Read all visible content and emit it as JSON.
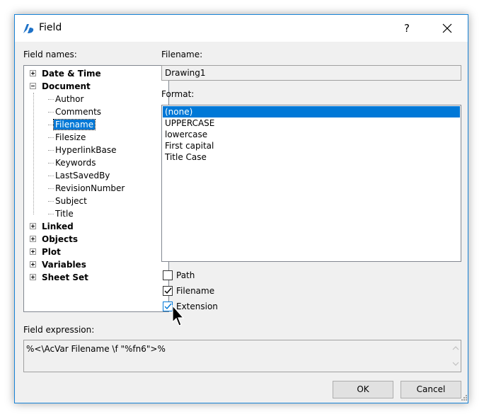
{
  "window": {
    "title": "Field",
    "help_label": "?"
  },
  "field_names": {
    "label": "Field names:",
    "tree": [
      {
        "label": "Date & Time",
        "bold": true,
        "expander": "plus"
      },
      {
        "label": "Document",
        "bold": true,
        "expander": "minus"
      },
      {
        "label": "Author",
        "child": true
      },
      {
        "label": "Comments",
        "child": true
      },
      {
        "label": "Filename",
        "child": true,
        "selected": true
      },
      {
        "label": "Filesize",
        "child": true
      },
      {
        "label": "HyperlinkBase",
        "child": true
      },
      {
        "label": "Keywords",
        "child": true
      },
      {
        "label": "LastSavedBy",
        "child": true
      },
      {
        "label": "RevisionNumber",
        "child": true
      },
      {
        "label": "Subject",
        "child": true
      },
      {
        "label": "Title",
        "child": true
      },
      {
        "label": "Linked",
        "bold": true,
        "expander": "plus"
      },
      {
        "label": "Objects",
        "bold": true,
        "expander": "plus"
      },
      {
        "label": "Plot",
        "bold": true,
        "expander": "plus"
      },
      {
        "label": "Variables",
        "bold": true,
        "expander": "plus"
      },
      {
        "label": "Sheet Set",
        "bold": true,
        "expander": "plus"
      }
    ]
  },
  "filename": {
    "label": "Filename:",
    "value": "Drawing1"
  },
  "format": {
    "label": "Format:",
    "options": [
      "(none)",
      "UPPERCASE",
      "lowercase",
      "First capital",
      "Title Case"
    ],
    "selected_index": 0
  },
  "checkboxes": {
    "path": {
      "label": "Path",
      "checked": false
    },
    "filename": {
      "label": "Filename",
      "checked": true
    },
    "extension": {
      "label": "Extension",
      "checked": true
    }
  },
  "expression": {
    "label": "Field expression:",
    "value": "%<\\AcVar Filename \\f \"%fn6\">%"
  },
  "buttons": {
    "ok": "OK",
    "cancel": "Cancel"
  },
  "colors": {
    "accent": "#0078d7",
    "window_border": "#1883d7",
    "dialog_bg": "#f0f0f0"
  }
}
